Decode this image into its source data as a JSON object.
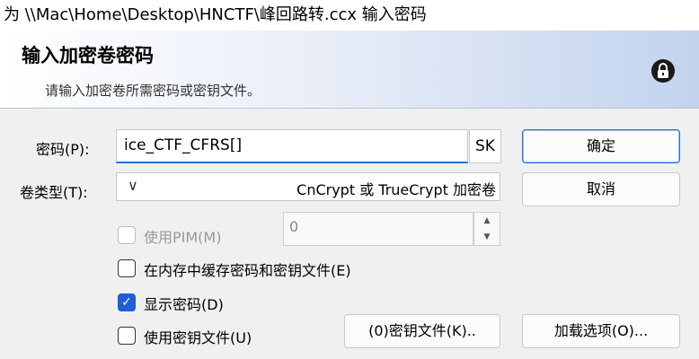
{
  "window": {
    "title": "为 \\\\Mac\\Home\\Desktop\\HNCTF\\峰回路转.ccx 输入密码"
  },
  "header": {
    "title": "输入加密卷密码",
    "subtitle": "请输入加密卷所需密码或密钥文件。",
    "icon": "lock-icon"
  },
  "form": {
    "password_label": "密码(P):",
    "password_value": "ice_CTF_CFRS[]",
    "sk_label": "SK",
    "volume_type_label": "卷类型(T):",
    "volume_type_value": "CnCrypt 或 TrueCrypt 加密卷",
    "use_pim_label": "使用PIM(M)",
    "pim_value": "0",
    "cache_label": "在内存中缓存密码和密钥文件(E)",
    "show_password_label": "显示密码(D)",
    "use_keyfiles_label": "使用密钥文件(U)"
  },
  "buttons": {
    "ok": "确定",
    "cancel": "取消",
    "keyfiles": "(0)密钥文件(K)..",
    "mount_options": "加载选项(O)..."
  },
  "state": {
    "use_pim": false,
    "cache": false,
    "show_password": true,
    "use_keyfiles": false
  },
  "colors": {
    "accent": "#1f5fd1"
  }
}
